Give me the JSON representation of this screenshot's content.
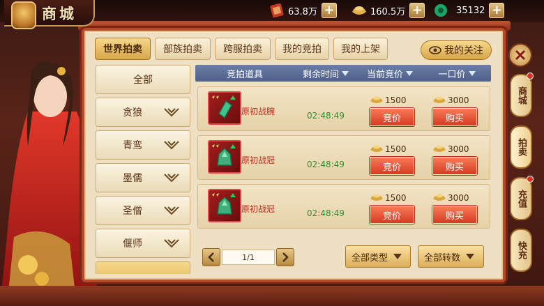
{
  "header": {
    "title": "商城",
    "currencies": [
      {
        "icon": "red-token-icon",
        "value": "63.8万"
      },
      {
        "icon": "gold-ingot-icon",
        "value": "160.5万"
      },
      {
        "icon": "jade-coin-icon",
        "value": "35132"
      }
    ],
    "plus_label": "+"
  },
  "tabs": [
    {
      "label": "世界拍卖",
      "active": true
    },
    {
      "label": "部族拍卖",
      "active": false
    },
    {
      "label": "跨服拍卖",
      "active": false
    },
    {
      "label": "我的竞拍",
      "active": false
    },
    {
      "label": "我的上架",
      "active": false
    }
  ],
  "follow_button": "我的关注",
  "categories": [
    {
      "label": "全部",
      "expandable": false
    },
    {
      "label": "贪狼",
      "expandable": true
    },
    {
      "label": "青鸾",
      "expandable": true
    },
    {
      "label": "墨儒",
      "expandable": true
    },
    {
      "label": "圣僧",
      "expandable": true
    },
    {
      "label": "偃师",
      "expandable": true
    }
  ],
  "table": {
    "columns": [
      "竞拍道具",
      "剩余时间",
      "当前竞价",
      "一口价"
    ],
    "rows": [
      {
        "name": "原初战腕",
        "time": "02:48:49",
        "bid": "1500",
        "buyout": "3000",
        "bid_btn": "竞价",
        "buy_btn": "购买"
      },
      {
        "name": "原初战冠",
        "time": "02:48:49",
        "bid": "1500",
        "buyout": "3000",
        "bid_btn": "竞价",
        "buy_btn": "购买"
      },
      {
        "name": "原初战冠",
        "time": "02:48:49",
        "bid": "1500",
        "buyout": "3000",
        "bid_btn": "竞价",
        "buy_btn": "购买"
      }
    ]
  },
  "pager": {
    "value": "1/1"
  },
  "filters": {
    "type_label": "全部类型",
    "reincarnation_label": "全部转数"
  },
  "side_tabs": [
    {
      "label": "商城"
    },
    {
      "label": "拍卖"
    },
    {
      "label": "充值"
    },
    {
      "label": "快充"
    }
  ],
  "colors": {
    "accent": "#d63a22",
    "frame": "#b84a2c",
    "header_blue": "#4d6089",
    "time_green": "#2f8d2f"
  }
}
